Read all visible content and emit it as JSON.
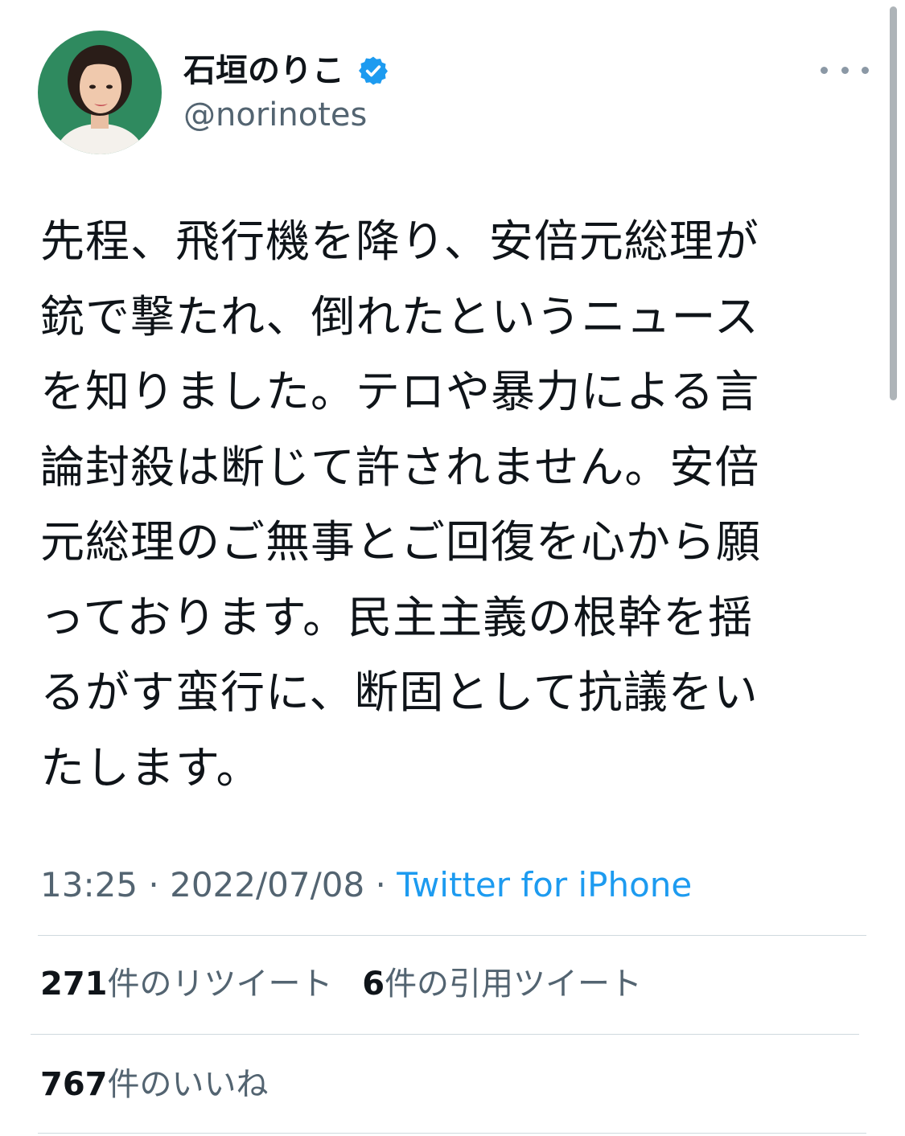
{
  "author": {
    "display_name": "石垣のりこ",
    "handle": "@norinotes",
    "verified_icon": "verified-badge-icon",
    "avatar_icon": "profile-photo"
  },
  "more_icon": "ellipsis-icon",
  "tweet": {
    "text": "先程、飛行機を降り、安倍元総理が\n銃で撃たれ、倒れたというニュース\nを知りました。テロや暴力による言\n論封殺は断じて許されません。安倍\n元総理のご無事とご回復を心から願\nっております。民主主義の根幹を揺\nるがす蛮行に、断固として抗議をい\nたします。"
  },
  "meta": {
    "time": "13:25",
    "separator1": " · ",
    "date": "2022/07/08",
    "separator2": " · ",
    "source": "Twitter for iPhone"
  },
  "stats": {
    "retweets_count": "271",
    "retweets_label": "件のリツイート",
    "quotes_count": "6",
    "quotes_label": "件の引用ツイート",
    "likes_count": "767",
    "likes_label": "件のいいね"
  },
  "colors": {
    "verified": "#1d9bf0",
    "link": "#1d9bf0",
    "secondary_text": "#536471",
    "divider": "#cfd9de",
    "avatar_background": "#2f8a5f"
  }
}
